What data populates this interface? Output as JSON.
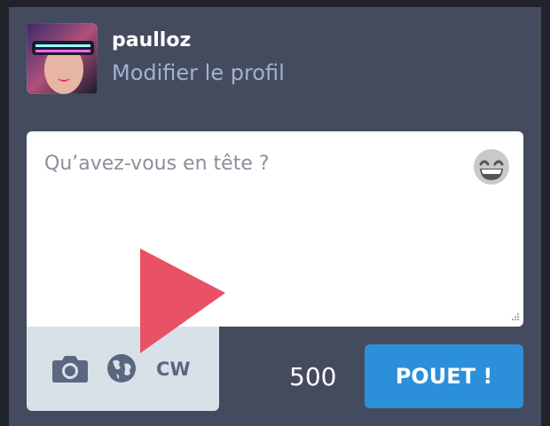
{
  "profile": {
    "username": "paulloz",
    "edit_label": "Modifier le profil"
  },
  "composer": {
    "placeholder": "Qu’avez-vous en tête ?",
    "emoji_icon": "grinning-face-icon",
    "char_counter": "500",
    "submit_label": "POUET !"
  },
  "toolbar": {
    "media_icon": "camera-icon",
    "visibility_icon": "globe-icon",
    "cw_label": "CW"
  },
  "colors": {
    "accent": "#2b90d9",
    "panel": "#454b5e",
    "link": "#9fb3d1",
    "overlay_arrow": "#e95164"
  }
}
